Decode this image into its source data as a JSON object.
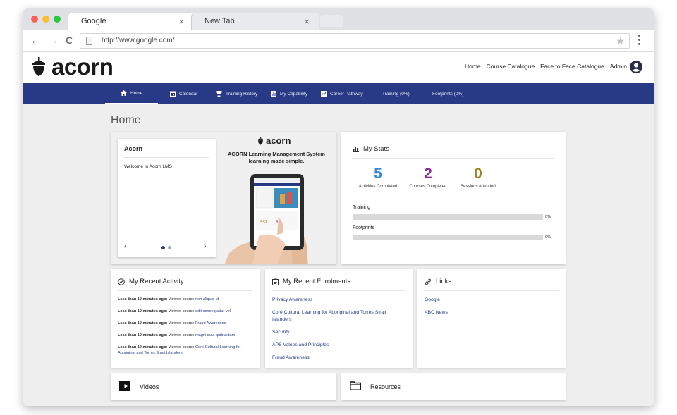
{
  "browser": {
    "tabs": [
      {
        "title": "Google",
        "close": "×"
      },
      {
        "title": "New Tab",
        "close": "×"
      }
    ],
    "nav": {
      "back": "←",
      "forward": "→",
      "reload": "C"
    },
    "url": "http://www.google.com/",
    "star": "★"
  },
  "app": {
    "logo": "acorn",
    "top_nav": [
      "Home",
      "Course Catalogue",
      "Face to Face Catalogue",
      "Admin"
    ],
    "main_nav": [
      {
        "label": "Home",
        "icon": "home-icon"
      },
      {
        "label": "Calendar",
        "icon": "calendar-icon"
      },
      {
        "label": "Training History",
        "icon": "trophy-icon"
      },
      {
        "label": "My Capability",
        "icon": "chart-icon"
      },
      {
        "label": "Career Pathway",
        "icon": "pathway-icon"
      },
      {
        "label": "Training (0%)",
        "icon": ""
      },
      {
        "label": "Footprints (0%)",
        "icon": ""
      }
    ],
    "accent": "#283a86"
  },
  "page": {
    "title": "Home",
    "banner": {
      "card_title": "Acorn",
      "card_text": "Welcome to Acorn LMS",
      "prev": "‹",
      "next": "›",
      "brand": "acorn",
      "line1": "ACORN Learning Management System",
      "line2": "learning made simple."
    },
    "stats": {
      "title": "My Stats",
      "items": [
        {
          "value": "5",
          "label": "Activities Completed",
          "color": "#3a86d8"
        },
        {
          "value": "2",
          "label": "Courses Completed",
          "color": "#8a2d9a"
        },
        {
          "value": "0",
          "label": "Sessions Attended",
          "color": "#9a8620"
        }
      ],
      "bars": [
        {
          "label": "Training",
          "pct": "0%",
          "value": 0.0
        },
        {
          "label": "Footprints",
          "pct": "0%",
          "value": 0.0
        }
      ]
    },
    "activity": {
      "title": "My Recent Activity",
      "items": [
        {
          "time": "Less than 10 minutes ago:",
          "text": " Viewed course ",
          "course": "non aliquid ut"
        },
        {
          "time": "Less than 10 minutes ago:",
          "text": " Viewed course ",
          "course": "odit consequatur vel"
        },
        {
          "time": "Less than 10 minutes ago:",
          "text": " Viewed course ",
          "course": "Fraud Awareness"
        },
        {
          "time": "Less than 10 minutes ago:",
          "text": " Viewed course ",
          "course": "magni quia quibusdam"
        },
        {
          "time": "Less than 10 minutes ago:",
          "text": " Viewed course ",
          "course": "Core Cultural Learning for Aboriginal and Torres Strait Islanders"
        }
      ]
    },
    "enrolments": {
      "title": "My Recent Enrolments",
      "items": [
        "Privacy Awareness",
        "Core Cultural Learning for Aboriginal and Torres Strait Islanders",
        "Security",
        "APS Values and Principles",
        "Fraud Awareness"
      ]
    },
    "links": {
      "title": "Links",
      "items": [
        "Google",
        "ABC News"
      ]
    },
    "videos": {
      "label": "Videos"
    },
    "resources": {
      "label": "Resources"
    }
  }
}
